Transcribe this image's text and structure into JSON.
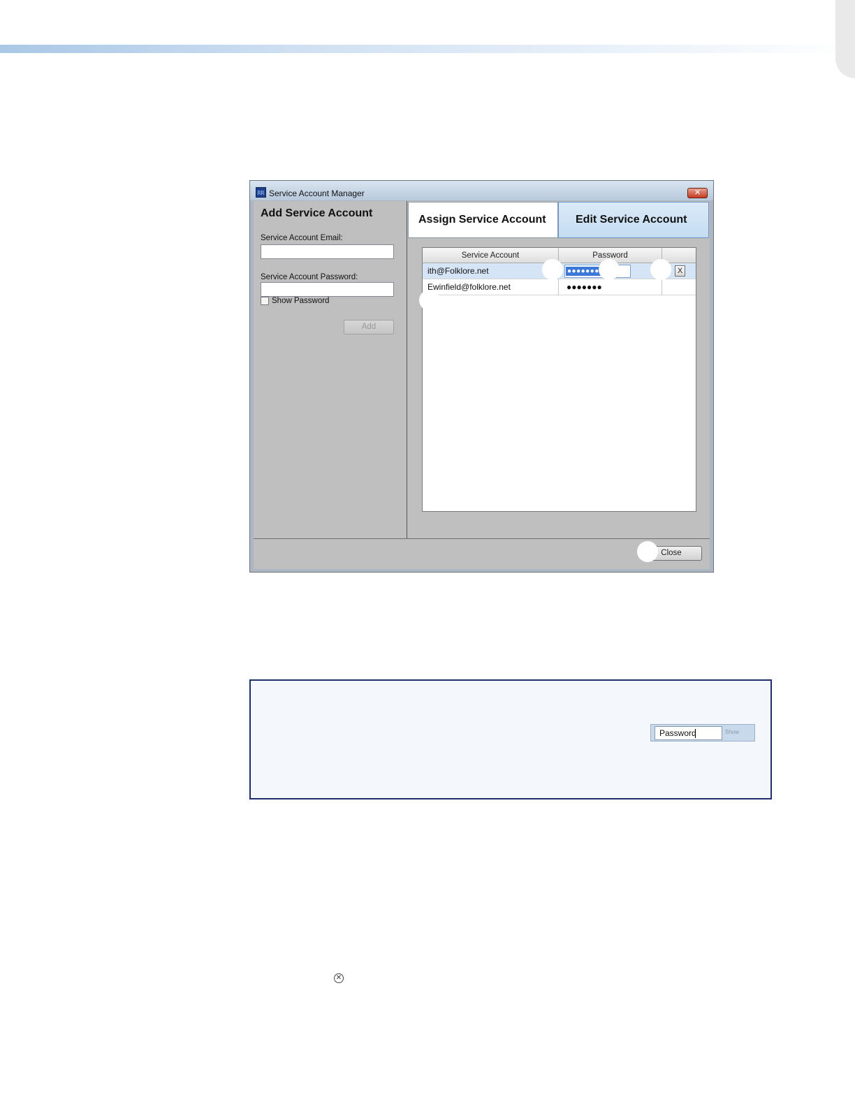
{
  "window": {
    "title": "Service Account Manager",
    "app_icon_text": "RR",
    "close_glyph": "✕"
  },
  "add_panel": {
    "title": "Add Service Account",
    "email_label": "Service Account Email:",
    "email_value": "",
    "password_label": "Service Account Password:",
    "password_value": "",
    "show_password_label": "Show Password",
    "show_password_checked": false,
    "add_label": "Add"
  },
  "tabs": [
    {
      "label": "Assign Service Account",
      "active": false
    },
    {
      "label": "Edit Service Account",
      "active": true
    }
  ],
  "table": {
    "columns": [
      "Service Account",
      "Password",
      ""
    ],
    "rows": [
      {
        "account": "ith@Folklore.net",
        "password": "●●●●●●●●●",
        "delete_label": "X",
        "selected": true
      },
      {
        "account": "Ewinfield@folklore.net",
        "password": "●●●●●●●",
        "delete_label": "",
        "selected": false
      }
    ]
  },
  "footer": {
    "close_label": "Close"
  },
  "note": {
    "password_field_value": "Password",
    "show_label": "Show"
  },
  "inline_icon": {
    "name": "circle-x-icon",
    "glyph": "✕"
  }
}
